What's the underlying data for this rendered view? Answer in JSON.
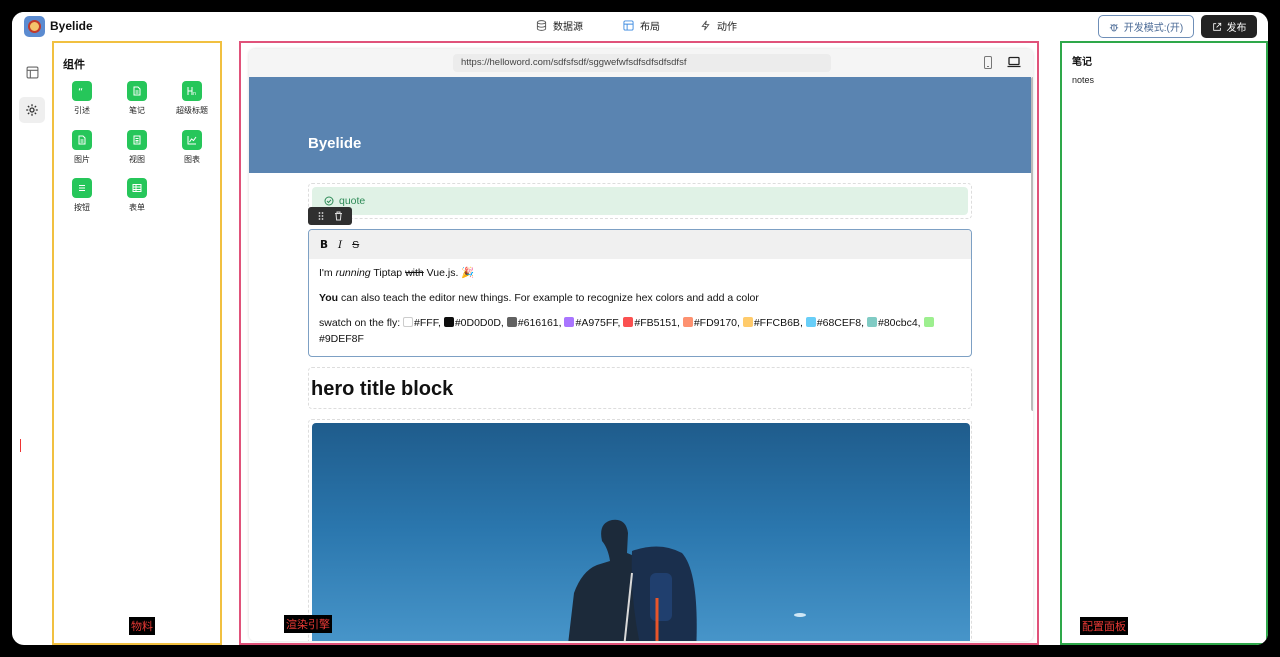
{
  "app": {
    "brand": "Byelide"
  },
  "nav": {
    "items": [
      {
        "label": "数据源",
        "icon": "database-icon"
      },
      {
        "label": "布局",
        "icon": "layout-icon"
      },
      {
        "label": "动作",
        "icon": "lightning-icon"
      }
    ]
  },
  "actions": {
    "dev_mode": "开发模式:(开)",
    "publish": "发布"
  },
  "rail": {
    "items": [
      {
        "icon": "layout-panel-icon"
      },
      {
        "icon": "settings-gear-icon",
        "active": true
      }
    ]
  },
  "materials": {
    "title": "组件",
    "components": [
      {
        "label": "引述",
        "icon": "quote-icon"
      },
      {
        "label": "笔记",
        "icon": "note-icon"
      },
      {
        "label": "超级标题",
        "icon": "heading-icon"
      },
      {
        "label": "图片",
        "icon": "image-icon"
      },
      {
        "label": "视图",
        "icon": "view-icon"
      },
      {
        "label": "图表",
        "icon": "chart-icon"
      },
      {
        "label": "按钮",
        "icon": "button-icon"
      },
      {
        "label": "表单",
        "icon": "table-icon"
      }
    ],
    "tag": "物料"
  },
  "engine": {
    "url": "https://helloword.com/sdfsfsdf/sggwefwfsdfsdfsdfsdfsf",
    "site_title": "Byelide",
    "quote": "quote",
    "editor": {
      "line1_a": "I'm ",
      "line1_b": "running",
      "line1_c": " Tiptap ",
      "line1_d": "with",
      "line1_e": " Vue.js. 🎉",
      "line2_a": "You",
      "line2_b": " can also teach the editor new things. For example to recognize hex colors and add a color",
      "line3": "swatch on the fly:",
      "swatches": [
        {
          "hex": "#FFF",
          "color": "#FFFFFF"
        },
        {
          "hex": "#0D0D0D",
          "color": "#0D0D0D"
        },
        {
          "hex": "#616161",
          "color": "#616161"
        },
        {
          "hex": "#A975FF",
          "color": "#A975FF"
        },
        {
          "hex": "#FB5151",
          "color": "#FB5151"
        },
        {
          "hex": "#FD9170",
          "color": "#FD9170"
        },
        {
          "hex": "#FFCB6B",
          "color": "#FFCB6B"
        },
        {
          "hex": "#68CEF8",
          "color": "#68CEF8"
        },
        {
          "hex": "#80cbc4",
          "color": "#80CBC4"
        },
        {
          "hex": "#9DEF8F",
          "color": "#9DEF8F"
        }
      ]
    },
    "hero_title": "hero title block",
    "tag": "渲染引擎"
  },
  "config": {
    "title": "笔记",
    "notes": "notes",
    "tag": "配置面板"
  },
  "colors": {
    "accent_green": "#26c65a",
    "materials_border": "#f1c040",
    "engine_border": "#e0527a",
    "config_border": "#2ea84a",
    "hero_bg": "#5a84b1"
  }
}
